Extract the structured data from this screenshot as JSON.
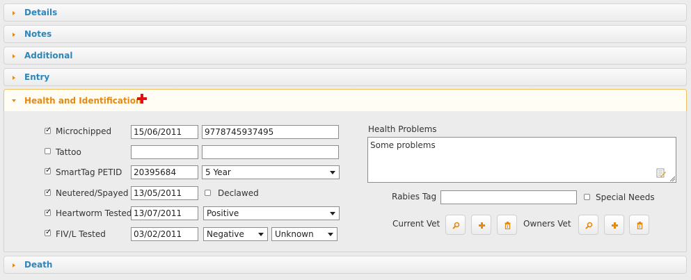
{
  "sections": {
    "details": "Details",
    "notes": "Notes",
    "additional": "Additional",
    "entry": "Entry",
    "health": "Health and Identification",
    "death": "Death"
  },
  "form": {
    "microchipped": {
      "label": "Microchipped",
      "checked": true,
      "date": "15/06/2011",
      "number": "9778745937495"
    },
    "tattoo": {
      "label": "Tattoo",
      "checked": false,
      "date": "",
      "number": ""
    },
    "smarttag": {
      "label": "SmartTag PETID",
      "checked": true,
      "id": "20395684",
      "type": "5 Year"
    },
    "neutered": {
      "label": "Neutered/Spayed",
      "checked": true,
      "date": "13/05/2011",
      "declawed_label": "Declawed",
      "declawed_checked": false
    },
    "heartworm": {
      "label": "Heartworm Tested",
      "checked": true,
      "date": "13/07/2011",
      "result": "Positive"
    },
    "fiv": {
      "label": "FIV/L Tested",
      "checked": true,
      "date": "03/02/2011",
      "result": "Negative",
      "result2": "Unknown"
    },
    "health_problems": {
      "label": "Health Problems",
      "value": "Some problems"
    },
    "rabies": {
      "label": "Rabies Tag",
      "value": ""
    },
    "special_needs": {
      "label": "Special Needs",
      "checked": false
    },
    "current_vet": {
      "label": "Current Vet"
    },
    "owners_vet": {
      "label": "Owners Vet"
    }
  },
  "colors": {
    "link": "#2e86b8",
    "accent": "#e48a14",
    "red_cross": "#e01010"
  },
  "icons": [
    "triangle-right-icon",
    "triangle-down-icon",
    "red-cross-icon",
    "search-icon",
    "plus-icon",
    "trash-icon",
    "edit-note-icon"
  ]
}
